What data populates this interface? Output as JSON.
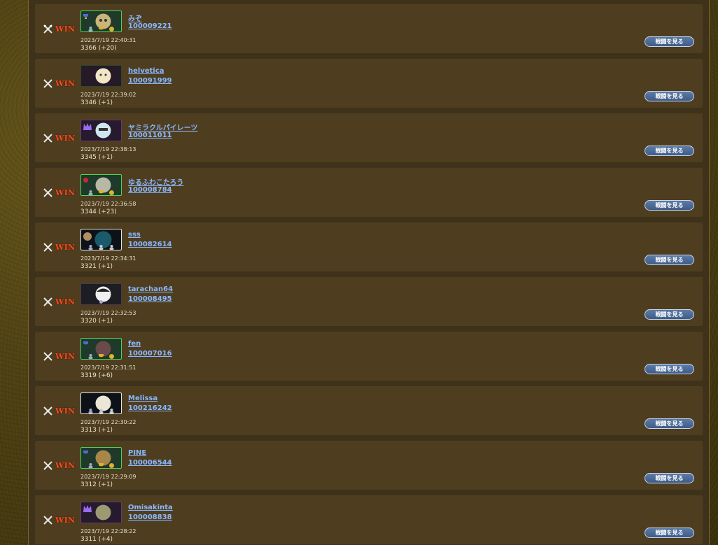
{
  "battles": [
    {
      "result": "WIN",
      "name": "みぞ",
      "id": "100009221",
      "datetime": "2023/7/19 22:40:31",
      "rating": "3366 (+20)",
      "button_label": "戦闘を見る",
      "card_style": "green",
      "face_color": "#c9b57a",
      "badges": [
        "trophy",
        "bust",
        "medal"
      ]
    },
    {
      "result": "WIN",
      "name": "helvetica",
      "id": "100091999",
      "datetime": "2023/7/19 22:39:02",
      "rating": "3346 (+1)",
      "button_label": "戦闘を見る",
      "card_style": "black",
      "face_color": "#f1e6c7",
      "badges": []
    },
    {
      "result": "WIN",
      "name": "ヤミラクルパイレーツ",
      "id": "100011011",
      "datetime": "2023/7/19 22:38:13",
      "rating": "3345 (+1)",
      "button_label": "戦闘を見る",
      "card_style": "purple",
      "face_color": "#cfe6ee",
      "badges": [
        "crown"
      ]
    },
    {
      "result": "WIN",
      "name": "ゆるふわこたろう",
      "id": "100008784",
      "datetime": "2023/7/19 22:36:58",
      "rating": "3344 (+23)",
      "button_label": "戦闘を見る",
      "card_style": "green",
      "face_color": "#b8b8a6",
      "badges": [
        "trophy",
        "bust",
        "medal"
      ]
    },
    {
      "result": "WIN",
      "name": "sss",
      "id": "100082614",
      "datetime": "2023/7/19 22:34:31",
      "rating": "3321 (+1)",
      "button_label": "戦闘を見る",
      "card_style": "white",
      "face_color": "#1b5a6a",
      "badges": [
        "trophy",
        "bust",
        "bust"
      ]
    },
    {
      "result": "WIN",
      "name": "tarachan64",
      "id": "100008495",
      "datetime": "2023/7/19 22:32:53",
      "rating": "3320 (+1)",
      "button_label": "戦闘を見る",
      "card_style": "dark",
      "face_color": "#f0f0f0",
      "badges": [
        "dot"
      ]
    },
    {
      "result": "WIN",
      "name": "fen",
      "id": "100007016",
      "datetime": "2023/7/19 22:31:51",
      "rating": "3319 (+6)",
      "button_label": "戦闘を見る",
      "card_style": "green",
      "face_color": "#6a4a4a",
      "badges": [
        "trophy",
        "bust",
        "medal"
      ]
    },
    {
      "result": "WIN",
      "name": "Melissa",
      "id": "100216242",
      "datetime": "2023/7/19 22:30:22",
      "rating": "3313 (+1)",
      "button_label": "戦闘を見る",
      "card_style": "white",
      "face_color": "#ece6d6",
      "badges": [
        "trophy",
        "bust",
        "bust"
      ]
    },
    {
      "result": "WIN",
      "name": "PINE",
      "id": "100006544",
      "datetime": "2023/7/19 22:29:09",
      "rating": "3312 (+1)",
      "button_label": "戦闘を見る",
      "card_style": "green",
      "face_color": "#a8864a",
      "badges": [
        "trophy",
        "bust",
        "medal"
      ]
    },
    {
      "result": "WIN",
      "name": "Omisakinta",
      "id": "100008838",
      "datetime": "2023/7/19 22:28:22",
      "rating": "3311 (+4)",
      "button_label": "戦闘を見る",
      "card_style": "purple",
      "face_color": "#9c9a72",
      "badges": [
        "crown"
      ]
    }
  ]
}
